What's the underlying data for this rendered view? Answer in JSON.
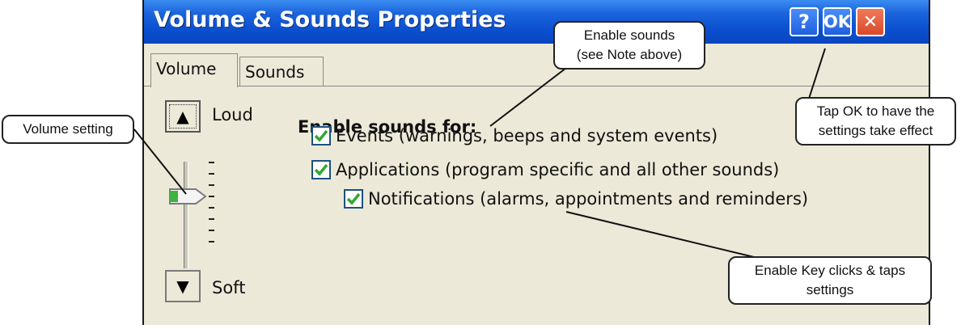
{
  "window": {
    "title": "Volume & Sounds Properties",
    "help_label": "?",
    "ok_label": "OK",
    "close_label": "✕"
  },
  "tabs": [
    {
      "label": "Volume",
      "selected": true
    },
    {
      "label": "Sounds",
      "selected": false
    }
  ],
  "volume": {
    "loud_label": "Loud",
    "soft_label": "Soft",
    "loud_arrow": "▲",
    "soft_arrow": "▼"
  },
  "sounds": {
    "heading": "Enable sounds for:",
    "options": [
      {
        "label": "Events (warnings, beeps and system events)",
        "checked": true
      },
      {
        "label": "Applications (program specific and all other sounds)",
        "checked": true
      },
      {
        "label": "Notifications (alarms, appointments and reminders)",
        "checked": true
      }
    ]
  },
  "annotations": {
    "volume_setting": "Volume setting",
    "enable_sounds_1": "Enable sounds",
    "enable_sounds_2": "(see Note above)",
    "ok_tip_1": "Tap OK to have the",
    "ok_tip_2": "settings take effect",
    "key_clicks_1": "Enable Key clicks & taps",
    "key_clicks_2": "settings"
  },
  "colors": {
    "titlebar": "#0a4fce",
    "window_bg": "#ece9d8",
    "check_green": "#2fa82f",
    "close_red": "#d84a2a"
  }
}
